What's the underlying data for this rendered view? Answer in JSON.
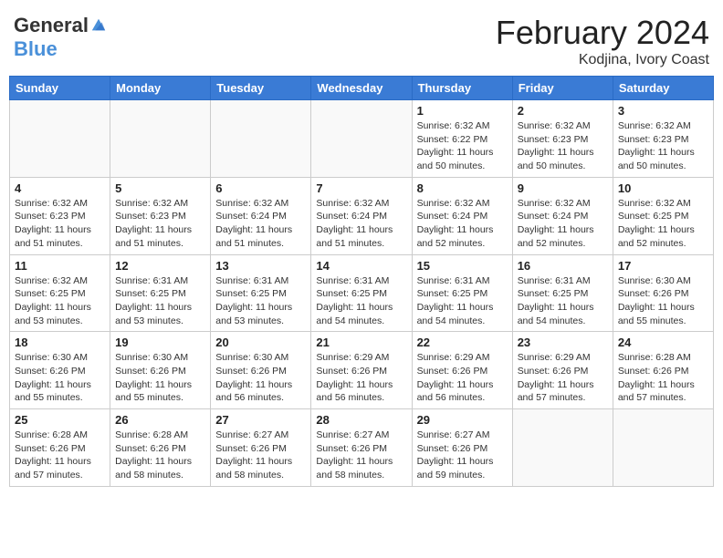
{
  "header": {
    "logo_general": "General",
    "logo_blue": "Blue",
    "month_year": "February 2024",
    "location": "Kodjina, Ivory Coast"
  },
  "days_of_week": [
    "Sunday",
    "Monday",
    "Tuesday",
    "Wednesday",
    "Thursday",
    "Friday",
    "Saturday"
  ],
  "weeks": [
    [
      {
        "day": "",
        "info": ""
      },
      {
        "day": "",
        "info": ""
      },
      {
        "day": "",
        "info": ""
      },
      {
        "day": "",
        "info": ""
      },
      {
        "day": "1",
        "info": "Sunrise: 6:32 AM\nSunset: 6:22 PM\nDaylight: 11 hours and 50 minutes."
      },
      {
        "day": "2",
        "info": "Sunrise: 6:32 AM\nSunset: 6:23 PM\nDaylight: 11 hours and 50 minutes."
      },
      {
        "day": "3",
        "info": "Sunrise: 6:32 AM\nSunset: 6:23 PM\nDaylight: 11 hours and 50 minutes."
      }
    ],
    [
      {
        "day": "4",
        "info": "Sunrise: 6:32 AM\nSunset: 6:23 PM\nDaylight: 11 hours and 51 minutes."
      },
      {
        "day": "5",
        "info": "Sunrise: 6:32 AM\nSunset: 6:23 PM\nDaylight: 11 hours and 51 minutes."
      },
      {
        "day": "6",
        "info": "Sunrise: 6:32 AM\nSunset: 6:24 PM\nDaylight: 11 hours and 51 minutes."
      },
      {
        "day": "7",
        "info": "Sunrise: 6:32 AM\nSunset: 6:24 PM\nDaylight: 11 hours and 51 minutes."
      },
      {
        "day": "8",
        "info": "Sunrise: 6:32 AM\nSunset: 6:24 PM\nDaylight: 11 hours and 52 minutes."
      },
      {
        "day": "9",
        "info": "Sunrise: 6:32 AM\nSunset: 6:24 PM\nDaylight: 11 hours and 52 minutes."
      },
      {
        "day": "10",
        "info": "Sunrise: 6:32 AM\nSunset: 6:25 PM\nDaylight: 11 hours and 52 minutes."
      }
    ],
    [
      {
        "day": "11",
        "info": "Sunrise: 6:32 AM\nSunset: 6:25 PM\nDaylight: 11 hours and 53 minutes."
      },
      {
        "day": "12",
        "info": "Sunrise: 6:31 AM\nSunset: 6:25 PM\nDaylight: 11 hours and 53 minutes."
      },
      {
        "day": "13",
        "info": "Sunrise: 6:31 AM\nSunset: 6:25 PM\nDaylight: 11 hours and 53 minutes."
      },
      {
        "day": "14",
        "info": "Sunrise: 6:31 AM\nSunset: 6:25 PM\nDaylight: 11 hours and 54 minutes."
      },
      {
        "day": "15",
        "info": "Sunrise: 6:31 AM\nSunset: 6:25 PM\nDaylight: 11 hours and 54 minutes."
      },
      {
        "day": "16",
        "info": "Sunrise: 6:31 AM\nSunset: 6:25 PM\nDaylight: 11 hours and 54 minutes."
      },
      {
        "day": "17",
        "info": "Sunrise: 6:30 AM\nSunset: 6:26 PM\nDaylight: 11 hours and 55 minutes."
      }
    ],
    [
      {
        "day": "18",
        "info": "Sunrise: 6:30 AM\nSunset: 6:26 PM\nDaylight: 11 hours and 55 minutes."
      },
      {
        "day": "19",
        "info": "Sunrise: 6:30 AM\nSunset: 6:26 PM\nDaylight: 11 hours and 55 minutes."
      },
      {
        "day": "20",
        "info": "Sunrise: 6:30 AM\nSunset: 6:26 PM\nDaylight: 11 hours and 56 minutes."
      },
      {
        "day": "21",
        "info": "Sunrise: 6:29 AM\nSunset: 6:26 PM\nDaylight: 11 hours and 56 minutes."
      },
      {
        "day": "22",
        "info": "Sunrise: 6:29 AM\nSunset: 6:26 PM\nDaylight: 11 hours and 56 minutes."
      },
      {
        "day": "23",
        "info": "Sunrise: 6:29 AM\nSunset: 6:26 PM\nDaylight: 11 hours and 57 minutes."
      },
      {
        "day": "24",
        "info": "Sunrise: 6:28 AM\nSunset: 6:26 PM\nDaylight: 11 hours and 57 minutes."
      }
    ],
    [
      {
        "day": "25",
        "info": "Sunrise: 6:28 AM\nSunset: 6:26 PM\nDaylight: 11 hours and 57 minutes."
      },
      {
        "day": "26",
        "info": "Sunrise: 6:28 AM\nSunset: 6:26 PM\nDaylight: 11 hours and 58 minutes."
      },
      {
        "day": "27",
        "info": "Sunrise: 6:27 AM\nSunset: 6:26 PM\nDaylight: 11 hours and 58 minutes."
      },
      {
        "day": "28",
        "info": "Sunrise: 6:27 AM\nSunset: 6:26 PM\nDaylight: 11 hours and 58 minutes."
      },
      {
        "day": "29",
        "info": "Sunrise: 6:27 AM\nSunset: 6:26 PM\nDaylight: 11 hours and 59 minutes."
      },
      {
        "day": "",
        "info": ""
      },
      {
        "day": "",
        "info": ""
      }
    ]
  ]
}
